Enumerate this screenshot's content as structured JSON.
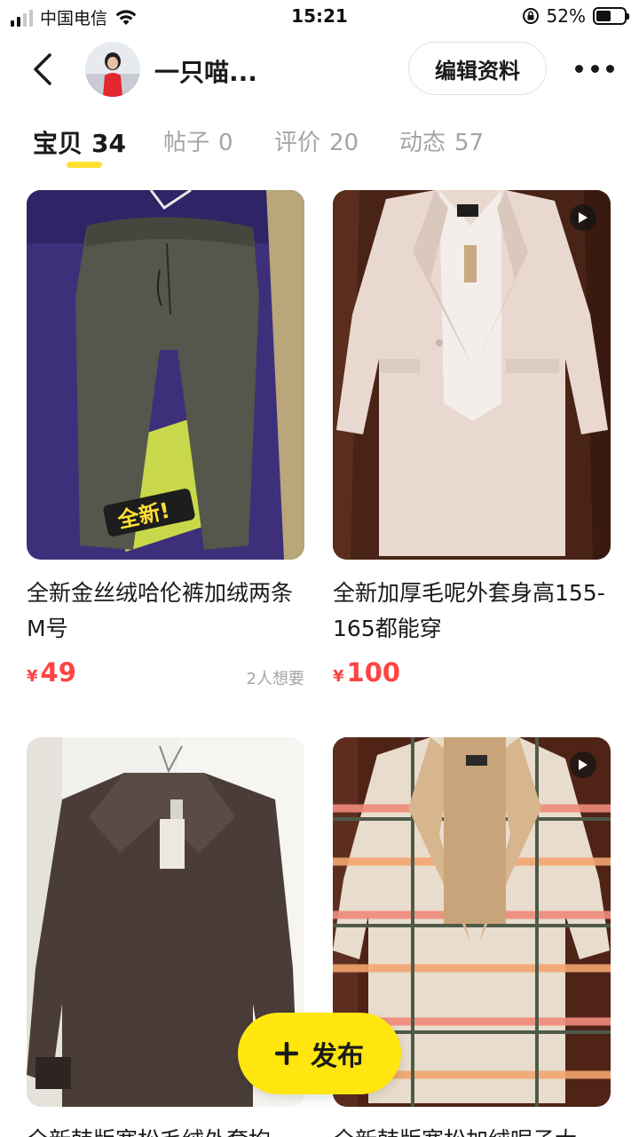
{
  "status_bar": {
    "carrier": "中国电信",
    "time": "15:21",
    "battery_percent": "52%",
    "battery_level": 0.52
  },
  "header": {
    "username": "一只喵...",
    "edit_label": "编辑资料",
    "back_icon": "chevron-left-icon",
    "more_icon": "more-dots-icon"
  },
  "tabs": [
    {
      "label": "宝贝",
      "count": "34",
      "active": true
    },
    {
      "label": "帖子",
      "count": "0",
      "active": false
    },
    {
      "label": "评价",
      "count": "20",
      "active": false
    },
    {
      "label": "动态",
      "count": "57",
      "active": false
    }
  ],
  "items": [
    {
      "title": "全新金丝绒哈伦裤加绒两条M号",
      "currency": "¥",
      "price": "49",
      "wants": "2人想要",
      "video": false
    },
    {
      "title": "全新加厚毛呢外套身高155-165都能穿",
      "currency": "¥",
      "price": "100",
      "wants": "",
      "video": true
    },
    {
      "title": "全新韩版宽松毛绒外套均",
      "currency": "",
      "price": "",
      "wants": "",
      "video": false
    },
    {
      "title": "全新韩版宽松加绒呢子大",
      "currency": "",
      "price": "",
      "wants": "",
      "video": true
    }
  ],
  "fab": {
    "label": "发布",
    "icon": "plus-icon"
  },
  "colors": {
    "accent_yellow": "#ffe60f",
    "price_red": "#ff4444",
    "muted": "#a5a5a5"
  }
}
